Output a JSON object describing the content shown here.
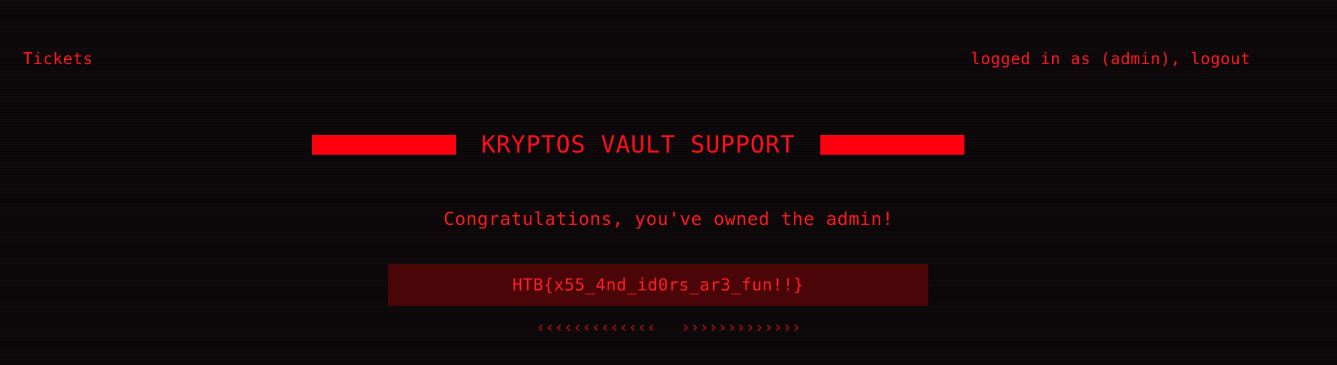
{
  "nav": {
    "tickets_label": "Tickets"
  },
  "session": {
    "prefix": "logged in as (admin), ",
    "logout_label": "logout"
  },
  "header": {
    "title": "KRYPTOS VAULT SUPPORT"
  },
  "main": {
    "congrats_message": "Congratulations, you've owned the admin!",
    "flag": "HTB{x55_4nd_id0rs_ar3_fun!!}",
    "arrows_left": "‹‹‹‹‹‹‹‹‹‹‹‹‹",
    "arrows_right": "›››››››››››››"
  },
  "colors": {
    "background": "#0b0708",
    "accent": "#ff0010",
    "text": "#ff1a22",
    "flag_box": "#4a0509"
  }
}
